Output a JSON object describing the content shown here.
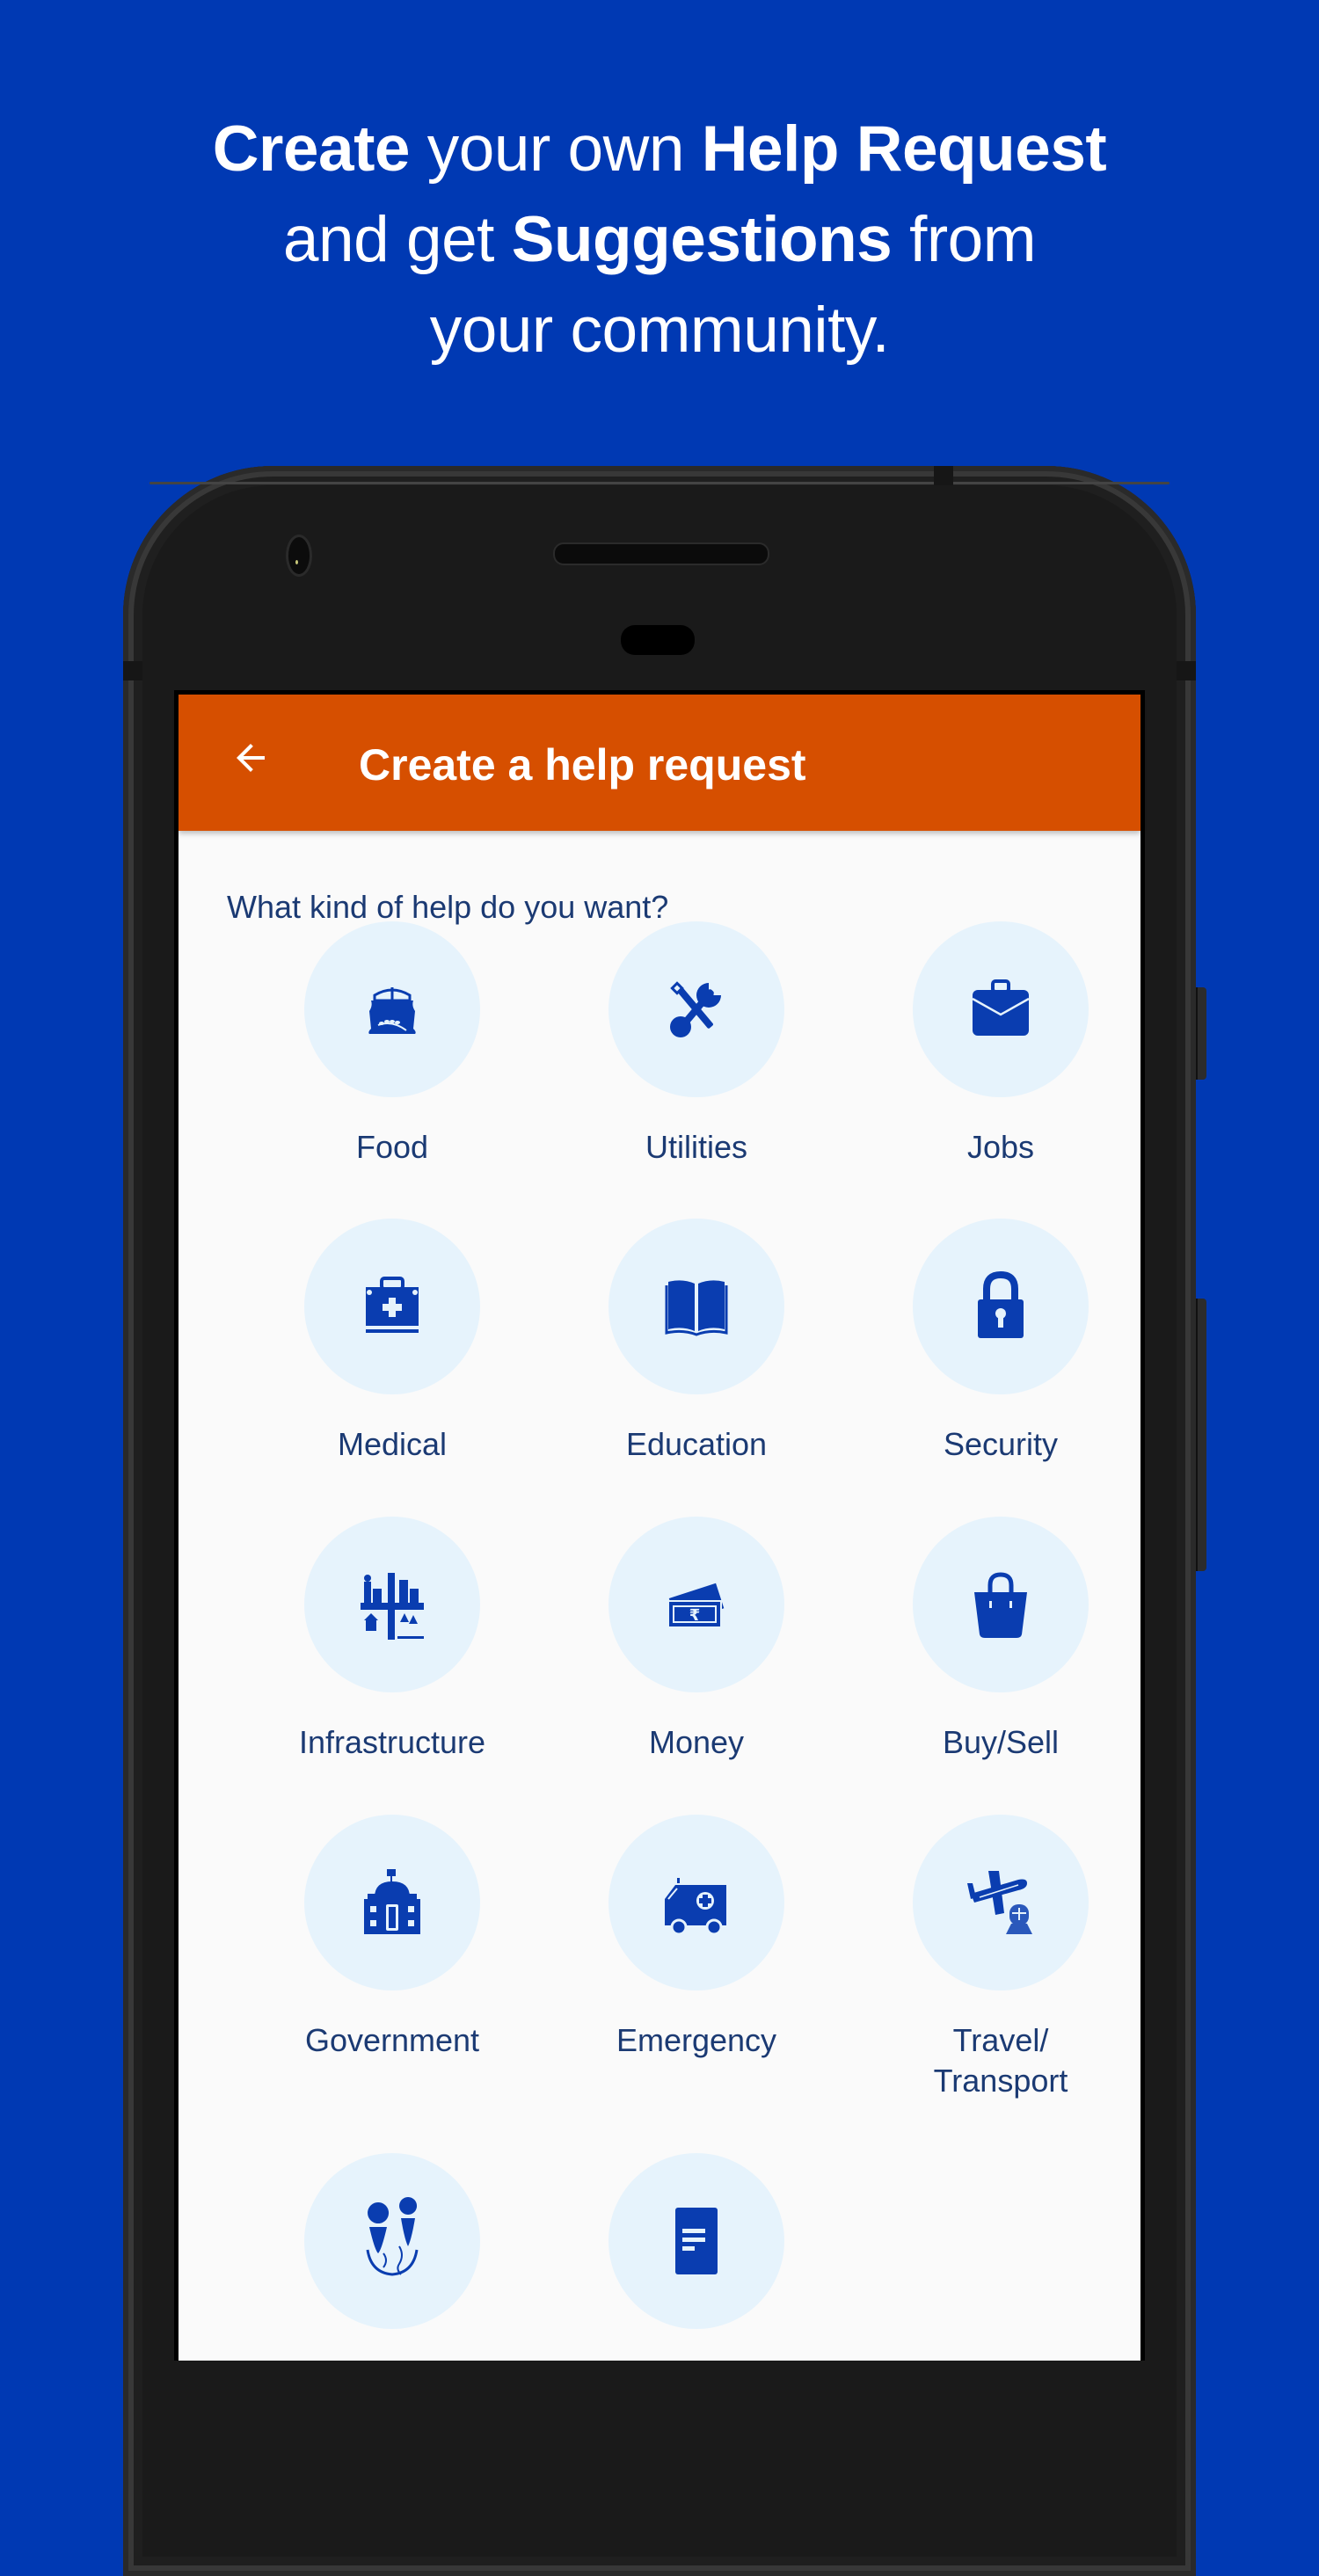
{
  "headline": {
    "line1": [
      {
        "text": "Create",
        "bold": true
      },
      {
        "text": " your own ",
        "bold": false
      },
      {
        "text": "Help Request",
        "bold": true
      }
    ],
    "line2": [
      {
        "text": "and get ",
        "bold": false
      },
      {
        "text": "Suggestions",
        "bold": true
      },
      {
        "text": " from",
        "bold": false
      }
    ],
    "line3": [
      {
        "text": "your community.",
        "bold": false
      }
    ]
  },
  "colors": {
    "background": "#0039b3",
    "appbar": "#d64f00",
    "icon": "#0a3db0",
    "circle": "#e6f3fc",
    "text": "#1b3a73"
  },
  "appbar": {
    "back_icon": "arrow-left-icon",
    "title": "Create a help request"
  },
  "prompt": "What kind of help do you want?",
  "categories": [
    {
      "label": "Food",
      "icon": "grain-sack-icon"
    },
    {
      "label": "Utilities",
      "icon": "tools-icon"
    },
    {
      "label": "Jobs",
      "icon": "briefcase-icon"
    },
    {
      "label": "Medical",
      "icon": "medical-kit-icon"
    },
    {
      "label": "Education",
      "icon": "book-icon"
    },
    {
      "label": "Security",
      "icon": "lock-icon"
    },
    {
      "label": "Infrastructure",
      "icon": "city-icon"
    },
    {
      "label": "Money",
      "icon": "rupee-notes-icon"
    },
    {
      "label": "Buy/Sell",
      "icon": "shopping-bag-icon"
    },
    {
      "label": "Government",
      "icon": "government-building-icon"
    },
    {
      "label": "Emergency",
      "icon": "ambulance-icon"
    },
    {
      "label": "Travel/\nTransport",
      "icon": "plane-train-icon"
    },
    {
      "label": "",
      "icon": "location-map-icon"
    },
    {
      "label": "",
      "icon": "document-icon"
    }
  ]
}
